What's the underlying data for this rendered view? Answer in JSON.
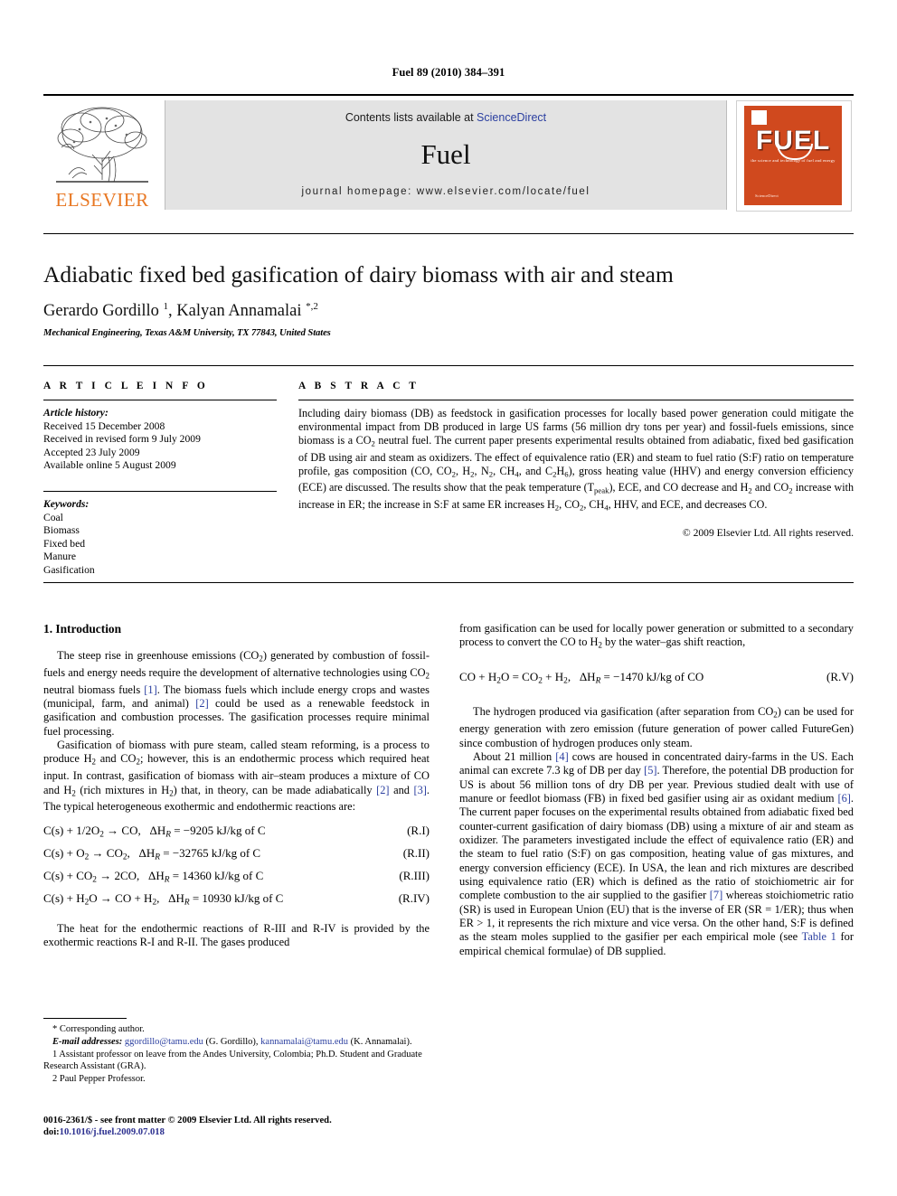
{
  "running_head": "Fuel 89 (2010) 384–391",
  "masthead": {
    "contents_text": "Contents lists available at ",
    "sciencedirect": "ScienceDirect",
    "journal_name": "Fuel",
    "homepage": "journal homepage: www.elsevier.com/locate/fuel",
    "publisher_name": "ELSEVIER",
    "cover_title": "FUEL",
    "cover_subtitle": "the science and technology of fuel and energy",
    "cover_footer": "ScienceDirect"
  },
  "article": {
    "title": "Adiabatic fixed bed gasification of dairy biomass with air and steam",
    "authors_html": "Gerardo Gordillo <sup>1</sup>, Kalyan Annamalai <sup>*,2</sup>",
    "affiliation": "Mechanical Engineering, Texas A&M University, TX 77843, United States"
  },
  "article_info": {
    "heading": "A R T I C L E  I N F O",
    "history_label": "Article history:",
    "history": [
      "Received 15 December 2008",
      "Received in revised form 9 July 2009",
      "Accepted 23 July 2009",
      "Available online 5 August 2009"
    ],
    "keywords_label": "Keywords:",
    "keywords": [
      "Coal",
      "Biomass",
      "Fixed bed",
      "Manure",
      "Gasification"
    ]
  },
  "abstract": {
    "heading": "A B S T R A C T",
    "body_html": "Including dairy biomass (DB) as feedstock in gasification processes for locally based power generation could mitigate the environmental impact from DB produced in large US farms (56 million dry tons per year) and fossil-fuels emissions, since biomass is a CO<sub>2</sub> neutral fuel. The current paper presents experimental results obtained from adiabatic, fixed bed gasification of DB using air and steam as oxidizers. The effect of equivalence ratio (ER) and steam to fuel ratio (S:F) ratio on temperature profile, gas composition (CO, CO<sub>2</sub>, H<sub>2</sub>, N<sub>2</sub>, CH<sub>4</sub>, and C<sub>2</sub>H<sub>6</sub>), gross heating value (HHV) and energy conversion efficiency (ECE) are discussed. The results show that the peak temperature (T<sub>peak</sub>), ECE, and CO decrease and H<sub>2</sub> and CO<sub>2</sub> increase with increase in ER; the increase in S:F at same ER increases H<sub>2</sub>, CO<sub>2</sub>, CH<sub>4</sub>, HHV, and ECE, and decreases CO.",
    "copyright": "© 2009 Elsevier Ltd. All rights reserved."
  },
  "body": {
    "section_heading": "1. Introduction",
    "left_paragraph_1_html": "The steep rise in greenhouse emissions (CO<sub>2</sub>) generated by combustion of fossil-fuels and energy needs require the development of alternative technologies using CO<sub>2</sub> neutral biomass fuels <span class=\"cit\">[1]</span>. The biomass fuels which include energy crops and wastes (municipal, farm, and animal) <span class=\"cit\">[2]</span> could be used as a renewable feedstock in gasification and combustion processes. The gasification processes require minimal fuel processing.",
    "left_paragraph_2_html": "Gasification of biomass with pure steam, called steam reforming, is a process to produce H<sub>2</sub> and CO<sub>2</sub>; however, this is an endothermic process which required heat input. In contrast, gasification of biomass with air–steam produces a mixture of CO and H<sub>2</sub> (rich mixtures in H<sub>2</sub>) that, in theory, can be made adiabatically <span class=\"cit\">[2]</span> and <span class=\"cit\">[3]</span>. The typical heterogeneous exothermic and endothermic reactions are:",
    "reactions": [
      {
        "formula_html": "C(s) + 1/2O<sub>2</sub> &#8594; CO,&nbsp;&nbsp; &Delta;H<sub><i>R</i></sub> = &#8722;9205 kJ/kg of C",
        "tag": "(R.I)"
      },
      {
        "formula_html": "C(s) + O<sub>2</sub> &#8594; CO<sub>2</sub>,&nbsp;&nbsp; &Delta;H<sub><i>R</i></sub> = &#8722;32765 kJ/kg of C",
        "tag": "(R.II)"
      },
      {
        "formula_html": "C(s) + CO<sub>2</sub> &#8594; 2CO,&nbsp;&nbsp; &Delta;H<sub><i>R</i></sub> = 14360 kJ/kg of C",
        "tag": "(R.III)"
      },
      {
        "formula_html": "C(s) + H<sub>2</sub>O &#8594; CO + H<sub>2</sub>,&nbsp;&nbsp; &Delta;H<sub><i>R</i></sub> = 10930 kJ/kg of C",
        "tag": "(R.IV)"
      }
    ],
    "left_paragraph_3_html": "The heat for the endothermic reactions of R-III and R-IV is provided by the exothermic reactions R-I and R-II. The gases produced",
    "right_paragraph_1_html": "from gasification can be used for locally power generation or submitted to a secondary process to convert the CO to H<sub>2</sub> by the water–gas shift reaction,",
    "reaction_rv": {
      "formula_html": "CO + H<sub>2</sub>O = CO<sub>2</sub> + H<sub>2</sub>,&nbsp;&nbsp; &Delta;H<sub><i>R</i></sub> = &#8722;1470 kJ/kg of CO",
      "tag": "(R.V)"
    },
    "right_paragraph_2_html": "The hydrogen produced via gasification (after separation from CO<sub>2</sub>) can be used for energy generation with zero emission (future generation of power called FutureGen) since combustion of hydrogen produces only steam.",
    "right_paragraph_3_html": "About 21 million <span class=\"cit\">[4]</span> cows are housed in concentrated dairy-farms in the US. Each animal can excrete 7.3 kg of DB per day <span class=\"cit\">[5]</span>. Therefore, the potential DB production for US is about 56 million tons of dry DB per year. Previous studied dealt with use of manure or feedlot biomass (FB) in fixed bed gasifier using air as oxidant medium <span class=\"cit\">[6]</span>. The current paper focuses on the experimental results obtained from adiabatic fixed bed counter-current gasification of dairy biomass (DB) using a mixture of air and steam as oxidizer. The parameters investigated include the effect of equivalence ratio (ER) and the steam to fuel ratio (S:F) on gas composition, heating value of gas mixtures, and energy conversion efficiency (ECE). In USA, the lean and rich mixtures are described using equivalence ratio (ER) which is defined as the ratio of stoichiometric air for complete combustion to the air supplied to the gasifier <span class=\"cit\">[7]</span> whereas stoichiometric ratio (SR) is used in European Union (EU) that is the inverse of ER (SR = 1/ER); thus when ER &gt; 1, it represents the rich mixture and vice versa. On the other hand, S:F is defined as the steam moles supplied to the gasifier per each empirical mole (see <span class=\"cit\">Table 1</span> for empirical chemical formulae) of DB supplied."
  },
  "footnotes": {
    "corresponding": "* Corresponding author.",
    "email_label": "E-mail addresses:",
    "email_1": "ggordillo@tamu.edu",
    "email_1_name": "(G. Gordillo),",
    "email_2": "kannamalai@tamu.edu",
    "email_2_name": "(K. Annamalai).",
    "note_1": "1 Assistant professor on leave from the Andes University, Colombia; Ph.D. Student and Graduate Research Assistant (GRA).",
    "note_2": "2 Paul Pepper Professor."
  },
  "imprint": {
    "line_1": "0016-2361/$ - see front matter © 2009 Elsevier Ltd. All rights reserved.",
    "doi_label": "doi:",
    "doi_value": "10.1016/j.fuel.2009.07.018"
  }
}
